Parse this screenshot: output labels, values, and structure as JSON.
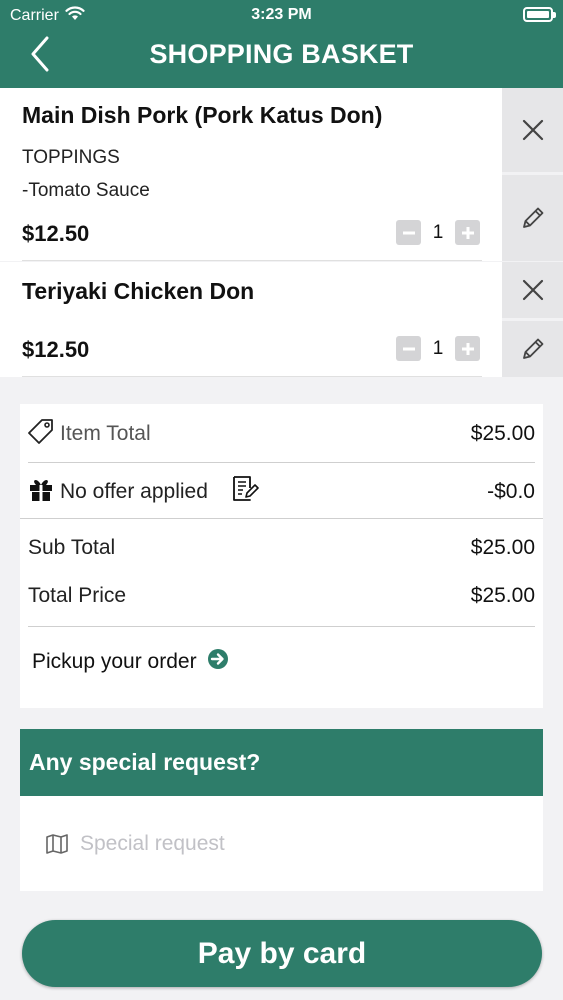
{
  "status_bar": {
    "carrier": "Carrier",
    "time": "3:23 PM"
  },
  "header": {
    "title": "SHOPPING BASKET"
  },
  "items": [
    {
      "name": "Main Dish Pork (Pork Katus Don)",
      "toppings_label": "TOPPINGS",
      "topping": "-Tomato Sauce",
      "price": "$12.50",
      "quantity": "1"
    },
    {
      "name": "Teriyaki Chicken Don",
      "price": "$12.50",
      "quantity": "1"
    }
  ],
  "summary": {
    "item_total_label": "Item Total",
    "item_total_value": "$25.00",
    "offer_label": "No offer applied",
    "offer_value": "-$0.0",
    "sub_total_label": "Sub Total",
    "sub_total_value": "$25.00",
    "total_price_label": "Total Price",
    "total_price_value": "$25.00",
    "pickup_label": "Pickup your order"
  },
  "special_request": {
    "heading": "Any special request?",
    "placeholder": "Special request"
  },
  "pay_button": {
    "label": "Pay by card"
  },
  "colors": {
    "primary": "#2e7d6a",
    "background": "#f2f2f4",
    "side_button": "#e6e6e8"
  }
}
